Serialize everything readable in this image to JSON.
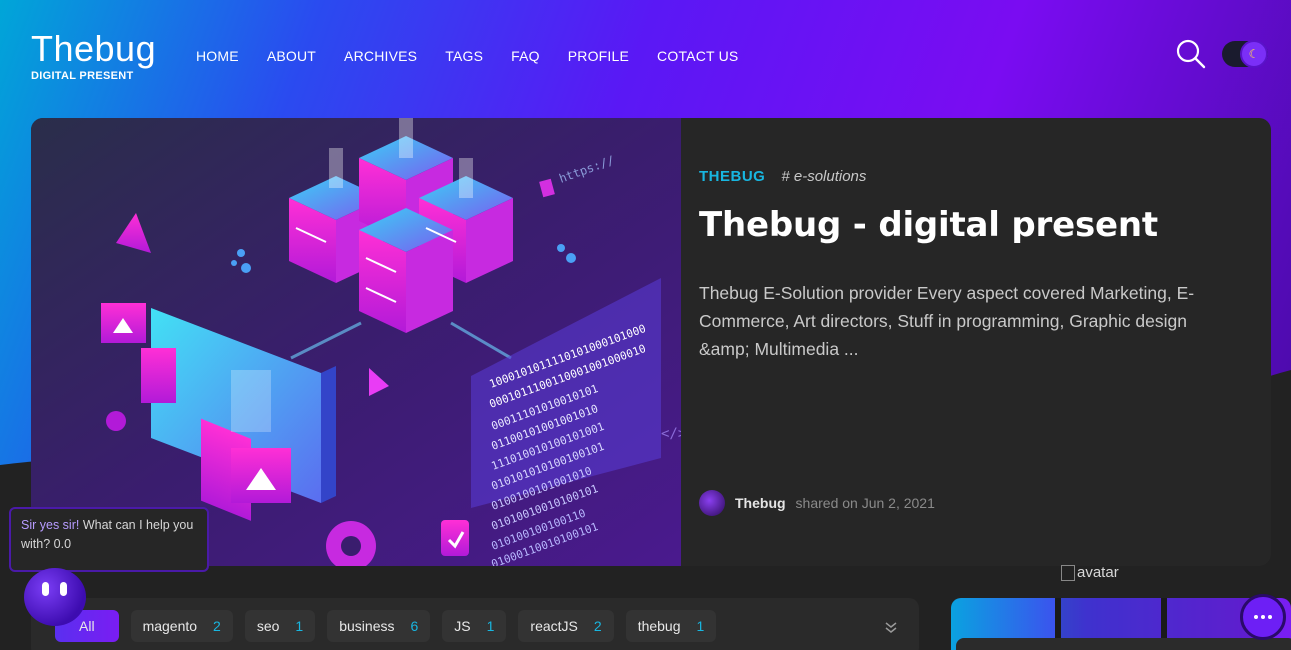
{
  "site": {
    "title": "Thebug",
    "subtitle": "DIGITAL PRESENT"
  },
  "nav": {
    "items": [
      "HOME",
      "ABOUT",
      "ARCHIVES",
      "TAGS",
      "FAQ",
      "PROFILE",
      "COTACT US"
    ]
  },
  "header_icons": {
    "search": "search-icon",
    "theme_toggle": "moon-icon"
  },
  "hero": {
    "category": "THEBUG",
    "tag": "# e-solutions",
    "title": "Thebug - digital present",
    "description": "Thebug E-Solution provider Every aspect covered Marketing, E-Commerce, Art directors, Stuff in programming, Graphic design &amp; Multimedia ...",
    "author": "Thebug",
    "shared": "shared on Jun 2, 2021",
    "art_code_text": [
      "1000101011110101000101000",
      "0001011100110001001000010",
      "00011101010010101",
      "01100101001001010",
      "111010010100101001",
      "010101010100100101",
      "0100100101001010",
      "01010010010100101",
      "010100100100110",
      "01000110010100101"
    ],
    "art_url_text": "https://",
    "art_code_symbol": "</>"
  },
  "chat": {
    "highlight": "Sir yes sir!",
    "message": " What can I help you with? 0.0"
  },
  "tags": [
    {
      "label": "All",
      "count": null,
      "active": true
    },
    {
      "label": "magento",
      "count": "2"
    },
    {
      "label": "seo",
      "count": "1"
    },
    {
      "label": "business",
      "count": "6"
    },
    {
      "label": "JS",
      "count": "1"
    },
    {
      "label": "reactJS",
      "count": "2"
    },
    {
      "label": "thebug",
      "count": "1"
    }
  ],
  "sidebar": {
    "avatar_alt": "avatar"
  },
  "colors": {
    "accent": "#18b6e0",
    "purple": "#7a1df2",
    "card_bg": "#262626"
  }
}
